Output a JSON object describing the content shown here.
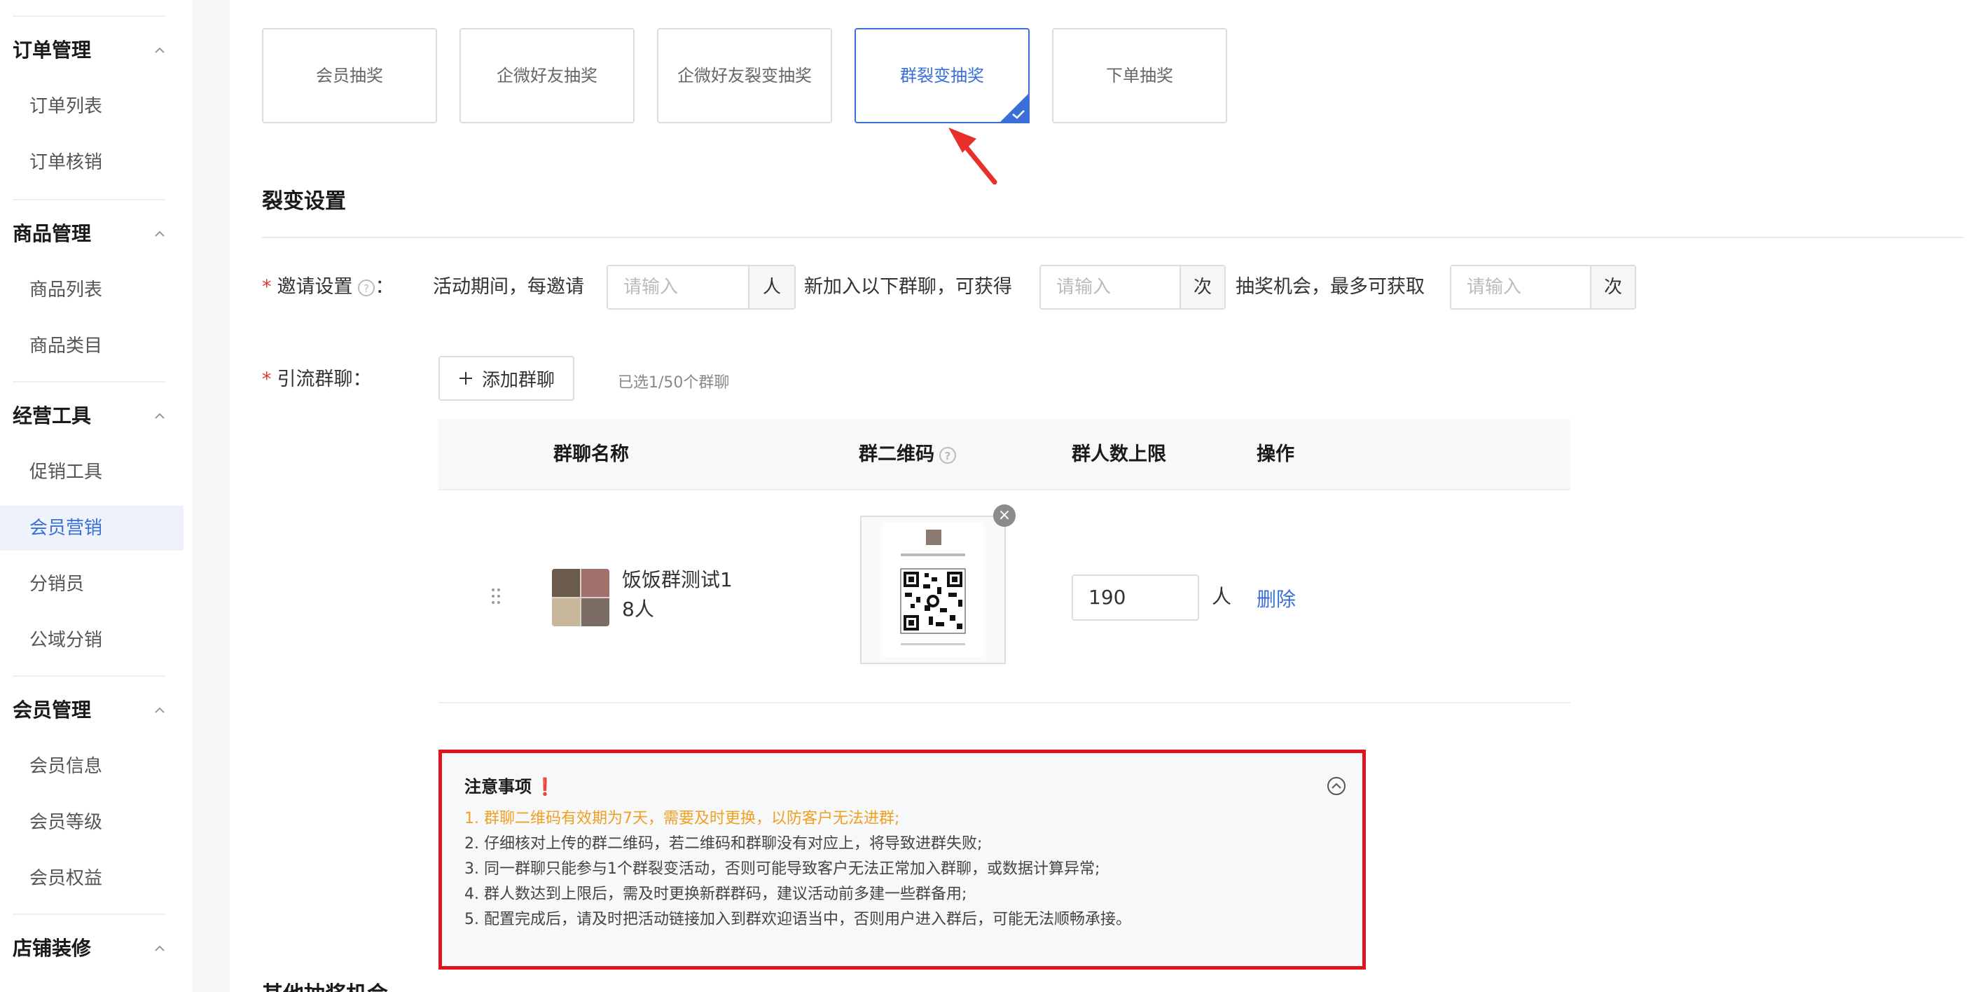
{
  "sidebar": {
    "groups": [
      {
        "title": "订单管理",
        "items": [
          "订单列表",
          "订单核销"
        ]
      },
      {
        "title": "商品管理",
        "items": [
          "商品列表",
          "商品类目"
        ]
      },
      {
        "title": "经营工具",
        "items": [
          "促销工具",
          "会员营销",
          "分销员",
          "公域分销"
        ]
      },
      {
        "title": "会员管理",
        "items": [
          "会员信息",
          "会员等级",
          "会员权益"
        ]
      },
      {
        "title": "店铺装修",
        "items": []
      }
    ],
    "active_item": "会员营销",
    "icons": {
      "collapse": "chevron-up-icon"
    }
  },
  "tabs": [
    {
      "label": "会员抽奖"
    },
    {
      "label": "企微好友抽奖"
    },
    {
      "label": "企微好友裂变抽奖"
    },
    {
      "label": "群裂变抽奖"
    },
    {
      "label": "下单抽奖"
    }
  ],
  "active_tab": "群裂变抽奖",
  "section": {
    "title": "裂变设置"
  },
  "invite": {
    "label": "邀请设置",
    "colon": "：",
    "text1": "活动期间，每邀请",
    "unit1": "人",
    "text2": "新加入以下群聊，可获得",
    "unit2": "次",
    "text3": "抽奖机会，最多可获取",
    "unit3": "次",
    "placeholder": "请输入"
  },
  "group_chat": {
    "label": "引流群聊：",
    "add_button": "添加群聊",
    "selected_text": "已选1/50个群聊"
  },
  "table": {
    "headers": [
      "群聊名称",
      "群二维码",
      "群人数上限",
      "操作"
    ],
    "rows": [
      {
        "name": "饭饭群测试1",
        "members": "8人",
        "limit": "190",
        "limit_unit": "人",
        "action": "删除"
      }
    ]
  },
  "notes": {
    "title": "注意事项",
    "mark": "❗",
    "lines": [
      "1. 群聊二维码有效期为7天，需要及时更换，以防客户无法进群;",
      "2. 仔细核对上传的群二维码，若二维码和群聊没有对应上，将导致进群失败;",
      "3. 同一群聊只能参与1个群裂变活动，否则可能导致客户无法正常加入群聊，或数据计算异常;",
      "4. 群人数达到上限后，需及时更换新群群码，建议活动前多建一些群备用;",
      "5. 配置完成后，请及时把活动链接加入到群欢迎语当中，否则用户进入群后，可能无法顺畅承接。"
    ]
  },
  "next_section": {
    "title": "其他抽奖机会"
  },
  "colors": {
    "accent": "#3a6fd8",
    "required": "#e0392f",
    "warning": "#f0a020",
    "highlight_border": "#e0141e"
  }
}
